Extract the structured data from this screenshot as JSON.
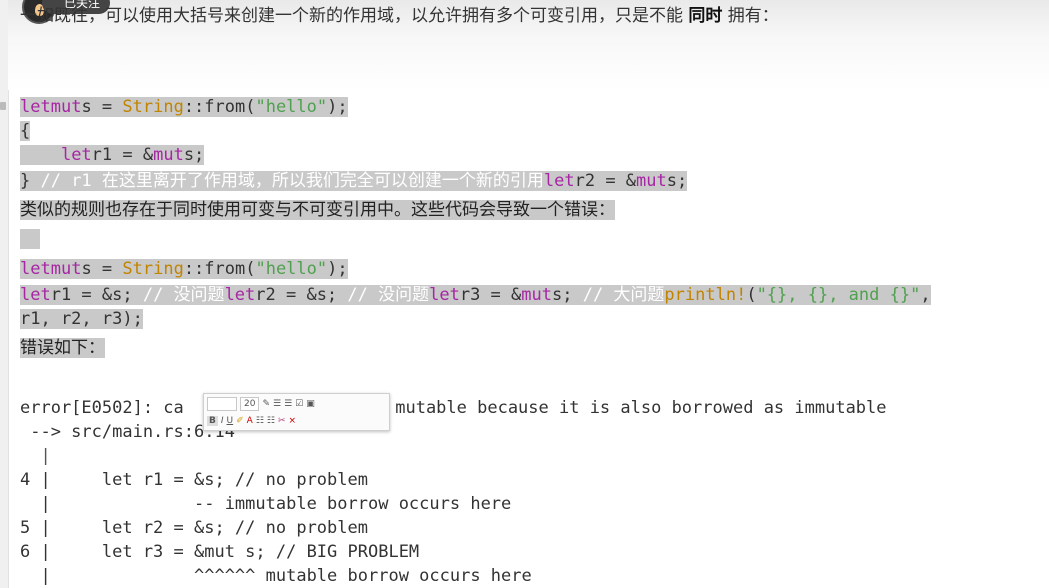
{
  "badge": {
    "follow_label": "已关注"
  },
  "intro": {
    "text_before": "一如既往，可以使用大括号来创建一个新的作用域，以允许拥有多个可变引用，只是不能 ",
    "bold": "同时",
    "text_after": " 拥有："
  },
  "block1": {
    "line1": {
      "kw1": "let",
      "kw2": "mut",
      "var": "s = ",
      "type": "String",
      "call": "::from(",
      "str": "\"hello\"",
      "end": ");"
    },
    "line2": "{",
    "line3": {
      "indent": "    ",
      "kw": "let",
      "rest1": "r1 = &",
      "kw2": "mut",
      "rest2": "s;"
    },
    "line4": {
      "brace": "} ",
      "comment": "// r1 ",
      "comment_zh": "在这里离开了作用域，所以我们完全可以创建一个新的引用",
      "kw": "let",
      "rest1": "r2 = &",
      "kw2": "mut",
      "rest2": "s;"
    }
  },
  "prose1": "类似的规则也存在于同时使用可变与不可变引用中。这些代码会导致一个错误：",
  "block2": {
    "line1": {
      "kw1": "let",
      "kw2": "mut",
      "var": "s = ",
      "type": "String",
      "call": "::from(",
      "str": "\"hello\"",
      "end": ");"
    },
    "line2": {
      "kw1": "let",
      "p1": "r1 = &s; ",
      "c1": "// ",
      "c1zh": "没问题",
      "kw2": "let",
      "p2": "r2 = &s; ",
      "c2": "// ",
      "c2zh": "没问题",
      "kw3": "let",
      "p3": "r3 = &",
      "kw4": "mut",
      "p4": "s; ",
      "c3": "// ",
      "c3zh": "大问题",
      "macro": "println!",
      "p5": "(",
      "fmt": "\"{}, {}, and {}\"",
      "p6": ","
    },
    "line3": "r1, r2, r3);"
  },
  "prose2": "错误如下：",
  "error": {
    "line1_a": "error[E0502]: ca",
    "line1_b": "s mutable because it is also borrowed as immutable",
    "line2": " --> src/main.rs:6:14",
    "line3": "  |",
    "line4": "4 |     let r1 = &s; // no problem",
    "line5": "  |              -- immutable borrow occurs here",
    "line6": "5 |     let r2 = &s; // no problem",
    "line7": "6 |     let r3 = &mut s; // BIG PROBLEM",
    "line8": "  |              ^^^^^^ mutable borrow occurs here"
  },
  "toolbar": {
    "font_size": "20",
    "bold_label": "B",
    "italic_label": "I",
    "underline_label": "U",
    "close_label": "×"
  }
}
